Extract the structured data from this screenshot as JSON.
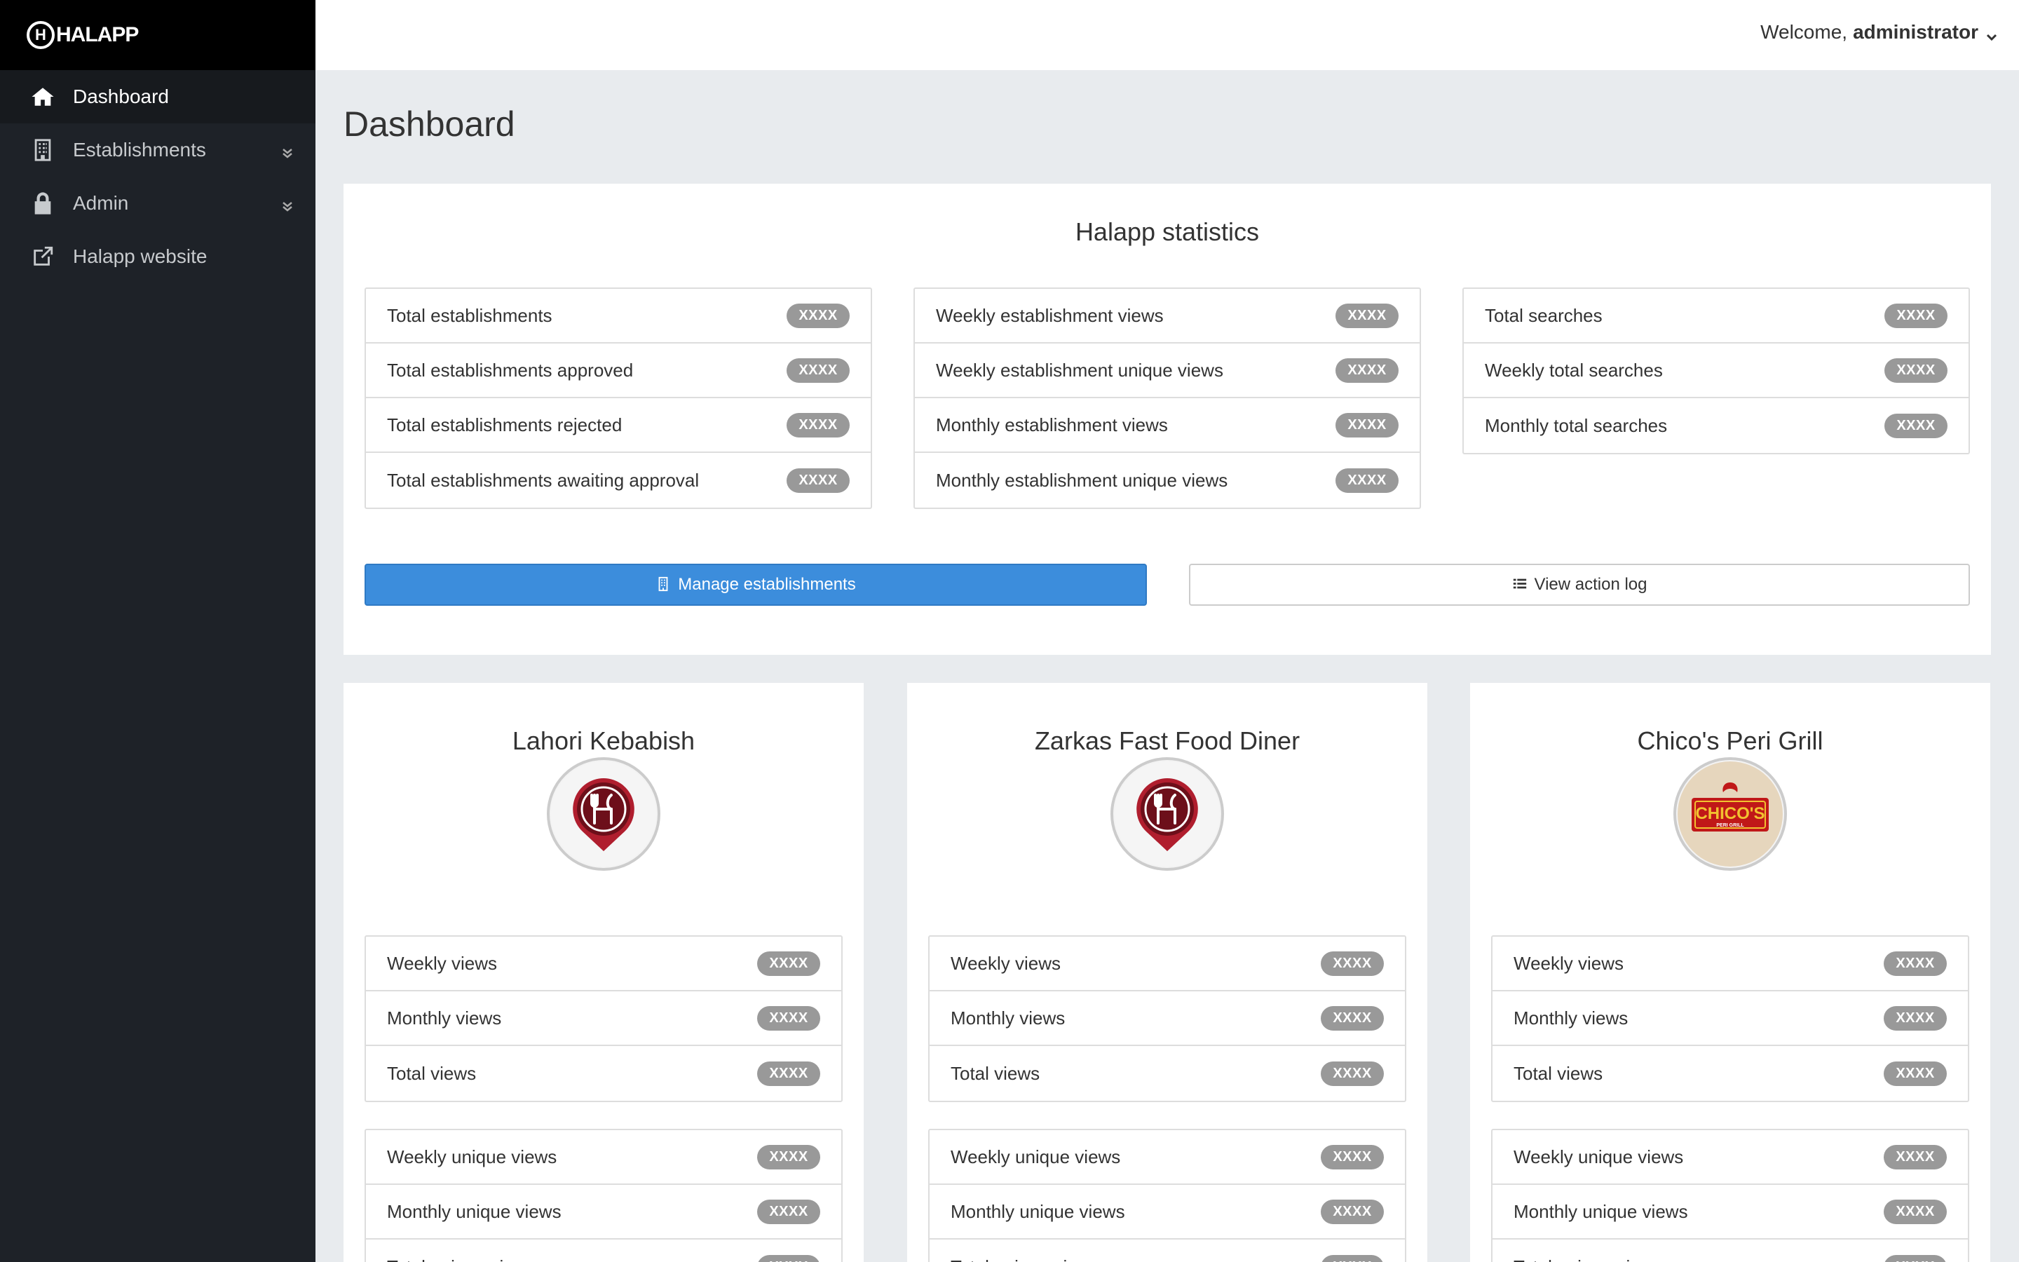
{
  "app": {
    "logo_text": "HALAPP"
  },
  "sidebar": {
    "items": [
      {
        "label": "Dashboard"
      },
      {
        "label": "Establishments"
      },
      {
        "label": "Admin"
      },
      {
        "label": "Halapp website"
      }
    ]
  },
  "topbar": {
    "welcome_prefix": "Welcome,",
    "username": "administrator"
  },
  "page": {
    "title": "Dashboard"
  },
  "stats": {
    "title": "Halapp statistics",
    "groups": [
      {
        "rows": [
          {
            "label": "Total establishments",
            "value": "XXXX"
          },
          {
            "label": "Total establishments approved",
            "value": "XXXX"
          },
          {
            "label": "Total establishments rejected",
            "value": "XXXX"
          },
          {
            "label": "Total establishments awaiting approval",
            "value": "XXXX"
          }
        ]
      },
      {
        "rows": [
          {
            "label": "Weekly establishment views",
            "value": "XXXX"
          },
          {
            "label": "Weekly establishment unique views",
            "value": "XXXX"
          },
          {
            "label": "Monthly establishment views",
            "value": "XXXX"
          },
          {
            "label": "Monthly establishment unique views",
            "value": "XXXX"
          }
        ]
      },
      {
        "rows": [
          {
            "label": "Total searches",
            "value": "XXXX"
          },
          {
            "label": "Weekly total searches",
            "value": "XXXX"
          },
          {
            "label": "Monthly total searches",
            "value": "XXXX"
          }
        ]
      }
    ],
    "manage_button": "Manage establishments",
    "log_button": "View action log"
  },
  "establishments": [
    {
      "name": "Lahori Kebabish",
      "logo": "halapp-default-logo",
      "views": [
        {
          "label": "Weekly views",
          "value": "XXXX"
        },
        {
          "label": "Monthly views",
          "value": "XXXX"
        },
        {
          "label": "Total views",
          "value": "XXXX"
        }
      ],
      "unique_views": [
        {
          "label": "Weekly unique views",
          "value": "XXXX"
        },
        {
          "label": "Monthly unique views",
          "value": "XXXX"
        },
        {
          "label": "Total unique views",
          "value": "XXXX"
        }
      ]
    },
    {
      "name": "Zarkas Fast Food Diner",
      "logo": "halapp-default-logo",
      "views": [
        {
          "label": "Weekly views",
          "value": "XXXX"
        },
        {
          "label": "Monthly views",
          "value": "XXXX"
        },
        {
          "label": "Total views",
          "value": "XXXX"
        }
      ],
      "unique_views": [
        {
          "label": "Weekly unique views",
          "value": "XXXX"
        },
        {
          "label": "Monthly unique views",
          "value": "XXXX"
        },
        {
          "label": "Total unique views",
          "value": "XXXX"
        }
      ]
    },
    {
      "name": "Chico's Peri Grill",
      "logo": "chicos-logo",
      "logo_text": "CHICO'S",
      "logo_subtext": "PERI GRILL",
      "views": [
        {
          "label": "Weekly views",
          "value": "XXXX"
        },
        {
          "label": "Monthly views",
          "value": "XXXX"
        },
        {
          "label": "Total views",
          "value": "XXXX"
        }
      ],
      "unique_views": [
        {
          "label": "Weekly unique views",
          "value": "XXXX"
        },
        {
          "label": "Monthly unique views",
          "value": "XXXX"
        },
        {
          "label": "Total unique views",
          "value": "XXXX"
        }
      ]
    }
  ],
  "colors": {
    "sidebar": "#1e2228",
    "primary": "#3c8ddc",
    "badge": "#999999",
    "brand_red": "#b01e2e"
  }
}
